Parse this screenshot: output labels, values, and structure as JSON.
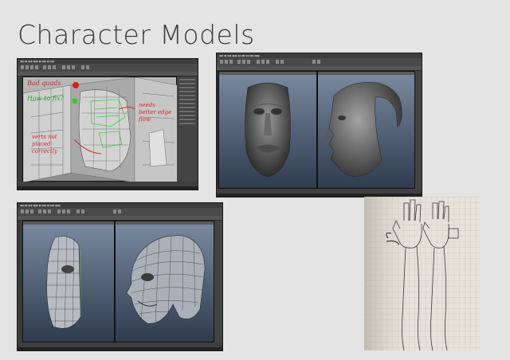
{
  "slide": {
    "title": "Character Models"
  },
  "screenshot_1": {
    "annotations": [
      "Bad quads",
      "How to fix?",
      "needs better edge flow",
      "verts not placed correctly"
    ]
  },
  "colors": {
    "background": "#e4e4e4",
    "maya_dark": "#2b2b2b",
    "viewport_top": "#7a8aa0",
    "viewport_bottom": "#2f3c4e",
    "annotation": "#d42a2a",
    "wire_green": "#39d339"
  },
  "icons": [
    "red-dot-icon",
    "green-square-icon"
  ]
}
